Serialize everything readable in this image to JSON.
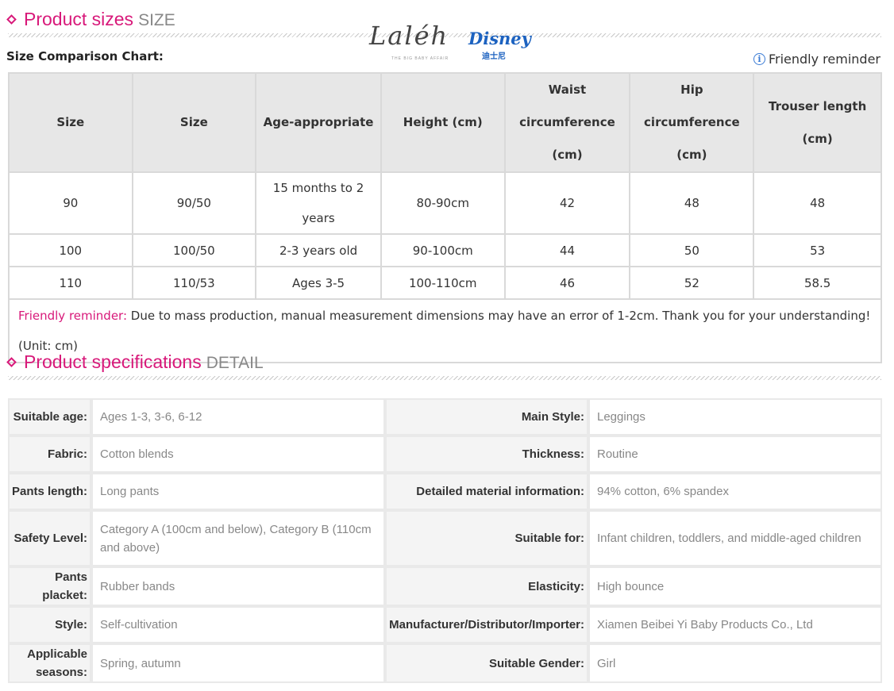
{
  "sizes_section": {
    "title": "Product sizes",
    "subtitle": "SIZE"
  },
  "logo": {
    "brand": "Laléh",
    "tagline": "THE BIG BABY AFFAIR",
    "partner": "Disney",
    "partner_cn": "迪士尼"
  },
  "size_chart": {
    "label": "Size Comparison Chart:",
    "reminder_link": "Friendly reminder",
    "headers": [
      "Size",
      "Size",
      "Age-appropriate",
      "Height (cm)",
      "Waist circumference (cm)",
      "Hip circumference (cm)",
      "Trouser length (cm)"
    ],
    "rows": [
      [
        "90",
        "90/50",
        "15 months to 2 years",
        "80-90cm",
        "42",
        "48",
        "48"
      ],
      [
        "100",
        "100/50",
        "2-3 years old",
        "90-100cm",
        "44",
        "50",
        "53"
      ],
      [
        "110",
        "110/53",
        "Ages 3-5",
        "100-110cm",
        "46",
        "52",
        "58.5"
      ]
    ],
    "note_label": "Friendly reminder:",
    "note_text": " Due to mass production, manual measurement dimensions may have an error of 1-2cm. Thank you for your understanding!",
    "unit": "(Unit: cm)"
  },
  "specs_section": {
    "title": "Product specifications",
    "subtitle": "DETAIL"
  },
  "specs": [
    {
      "k1": "Suitable age:",
      "v1": "Ages 1-3, 3-6, 6-12",
      "k2": "Main Style:",
      "v2": "Leggings"
    },
    {
      "k1": "Fabric:",
      "v1": "Cotton blends",
      "k2": "Thickness:",
      "v2": "Routine"
    },
    {
      "k1": "Pants length:",
      "v1": "Long pants",
      "k2": "Detailed material information:",
      "v2": "94% cotton, 6% spandex"
    },
    {
      "k1": "Safety Level:",
      "v1": "Category A (100cm and below), Category B (110cm and above)",
      "k2": "Suitable for:",
      "v2": "Infant children, toddlers, and middle-aged children"
    },
    {
      "k1": "Pants placket:",
      "v1": "Rubber bands",
      "k2": "Elasticity:",
      "v2": "High bounce"
    },
    {
      "k1": "Style:",
      "v1": "Self-cultivation",
      "k2": "Manufacturer/Distributor/Importer:",
      "v2": "Xiamen Beibei Yi Baby Products Co., Ltd"
    },
    {
      "k1": "Applicable seasons:",
      "v1": "Spring, autumn",
      "k2": "Suitable Gender:",
      "v2": "Girl"
    }
  ]
}
